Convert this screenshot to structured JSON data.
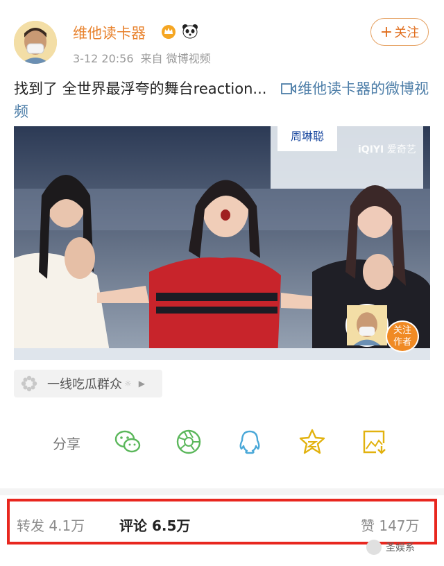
{
  "post": {
    "author": "维他读卡器",
    "date": "3-12 20:56",
    "source": "来自 微博视频",
    "follow_label": "关注",
    "follow_plus": "+",
    "text": "找到了 全世界最浮夸的舞台reaction...",
    "video_link_text": "维他读卡器的微博视频"
  },
  "video": {
    "follow_author_line1": "关注",
    "follow_author_line2": "作者",
    "logo_text": "爱奇艺",
    "name_tag": "周琳聪"
  },
  "topic": {
    "label": "一线吃瓜群众",
    "icon": "flower-icon"
  },
  "share": {
    "label": "分享",
    "targets": [
      "wechat-icon",
      "moments-icon",
      "qq-icon",
      "qzone-icon",
      "save-image-icon"
    ]
  },
  "stats": {
    "repost_label": "转发",
    "repost_count": "4.1万",
    "comment_label": "评论",
    "comment_count": "6.5万",
    "like_label": "赞",
    "like_count": "147万"
  },
  "watermark": {
    "text": "圣娱系"
  },
  "colors": {
    "accent_orange": "#e8822d",
    "link_blue": "#4d7ea8",
    "share_green": "#5bb75b",
    "share_blue": "#4aa8d8",
    "share_yellow": "#e2b20f",
    "highlight_red": "#e8271f"
  }
}
